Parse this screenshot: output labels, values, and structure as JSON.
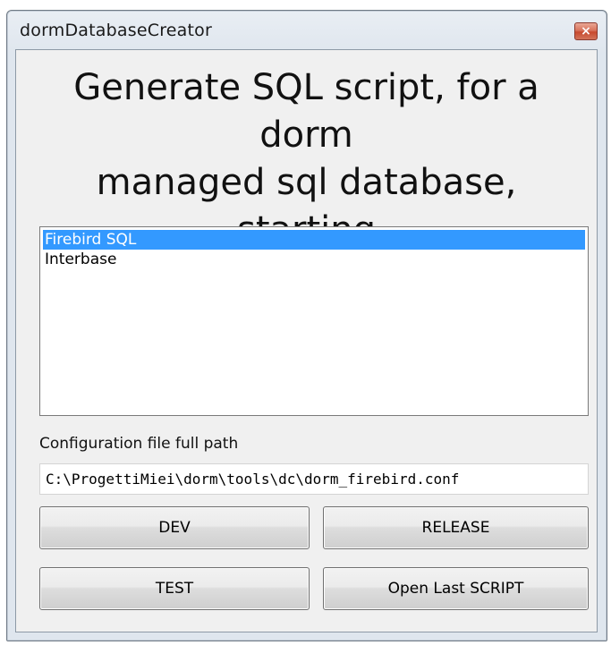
{
  "window": {
    "title": "dormDatabaseCreator",
    "close_glyph": "×"
  },
  "main": {
    "heading": "Generate SQL script, for a dorm\nmanaged sql database, starting\nfrom configuration file",
    "database_list": {
      "items": [
        {
          "label": "Firebird SQL",
          "selected": true
        },
        {
          "label": "Interbase",
          "selected": false
        }
      ]
    },
    "config_path": {
      "label": "Configuration file full path",
      "value": "C:\\ProgettiMiei\\dorm\\tools\\dc\\dorm_firebird.conf"
    },
    "buttons": {
      "dev": "DEV",
      "release": "RELEASE",
      "test": "TEST",
      "open_last_script": "Open Last SCRIPT"
    }
  },
  "colors": {
    "selection": "#3399ff",
    "close_button": "#c84a2f"
  }
}
